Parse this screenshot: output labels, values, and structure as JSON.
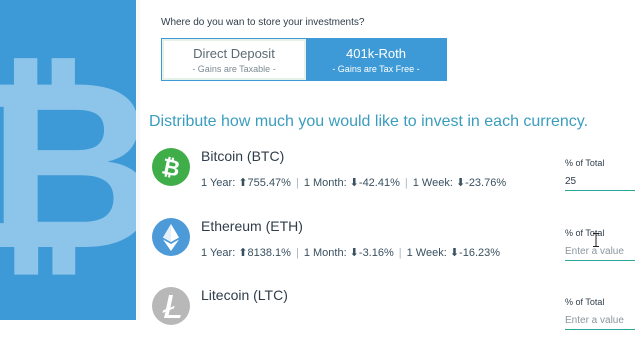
{
  "question": "Where do you wan to store your investments?",
  "account_options": [
    {
      "title": "Direct Deposit",
      "subtitle": "- Gains are Taxable -",
      "active": false
    },
    {
      "title": "401k-Roth",
      "subtitle": "- Gains are Tax Free -",
      "active": true
    }
  ],
  "distribute_text": "Distribute how much you would like to invest in each currency.",
  "colors": {
    "sidebar": "#3d9ad6",
    "accent": "#3d9ad6",
    "btc": "#3fae49",
    "eth": "#4d9ad8",
    "ltc": "#b8b8b8",
    "heading": "#3a9dbf"
  },
  "coins": [
    {
      "name": "Bitcoin (BTC)",
      "icon": "bitcoin-icon",
      "year": "1 Year: ⬆755.47%",
      "month": "1 Month: ⬇-42.41%",
      "week": "1 Week: ⬇-23.76%",
      "pct_label": "% of Total",
      "pct_value": "25",
      "pct_placeholder": ""
    },
    {
      "name": "Ethereum (ETH)",
      "icon": "ethereum-icon",
      "year": "1 Year: ⬆8138.1%",
      "month": "1 Month: ⬇-3.16%",
      "week": "1 Week: ⬇-16.23%",
      "pct_label": "% of Total",
      "pct_value": "",
      "pct_placeholder": "Enter a value"
    },
    {
      "name": "Litecoin (LTC)",
      "icon": "litecoin-icon",
      "year": "",
      "month": "",
      "week": "",
      "pct_label": "% of Total",
      "pct_value": "",
      "pct_placeholder": "Enter a value"
    }
  ]
}
